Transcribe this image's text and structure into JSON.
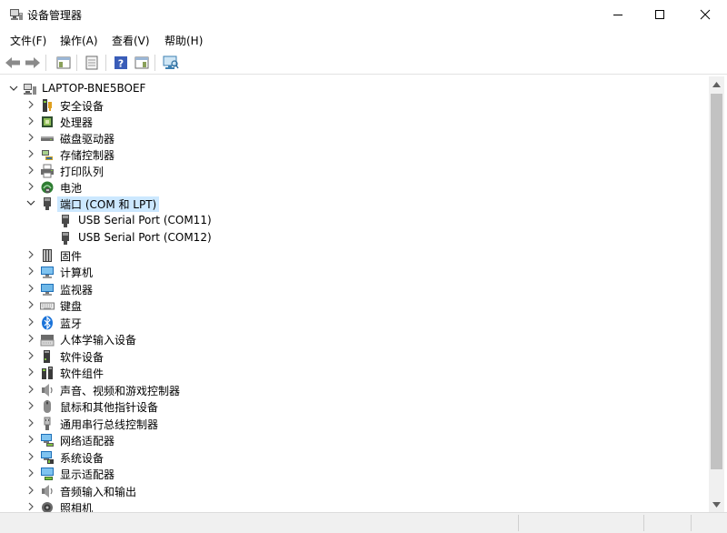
{
  "window": {
    "title": "设备管理器",
    "controls": {
      "minimize": "—",
      "maximize": "☐",
      "close": "✕"
    }
  },
  "menu": [
    {
      "label": "文件(F)"
    },
    {
      "label": "操作(A)"
    },
    {
      "label": "查看(V)"
    },
    {
      "label": "帮助(H)"
    }
  ],
  "toolbar": {
    "buttons": [
      "back-arrow-icon",
      "forward-arrow-icon",
      "show-hide-tree-icon",
      "properties-icon",
      "help-icon",
      "console-icon",
      "monitor-scan-icon"
    ]
  },
  "tree": {
    "root": "LAPTOP-BNE5BOEF",
    "items": [
      {
        "label": "安全设备",
        "icon": "security-device-icon"
      },
      {
        "label": "处理器",
        "icon": "processor-icon"
      },
      {
        "label": "磁盘驱动器",
        "icon": "disk-drive-icon"
      },
      {
        "label": "存储控制器",
        "icon": "storage-controller-icon"
      },
      {
        "label": "打印队列",
        "icon": "printer-icon"
      },
      {
        "label": "电池",
        "icon": "battery-icon"
      },
      {
        "label": "端口 (COM 和 LPT)",
        "icon": "port-icon",
        "expanded": true,
        "selected": true,
        "children": [
          {
            "label": "USB Serial Port (COM11)",
            "icon": "port-icon"
          },
          {
            "label": "USB Serial Port (COM12)",
            "icon": "port-icon"
          }
        ]
      },
      {
        "label": "固件",
        "icon": "firmware-icon"
      },
      {
        "label": "计算机",
        "icon": "computer-icon"
      },
      {
        "label": "监视器",
        "icon": "monitor-icon"
      },
      {
        "label": "键盘",
        "icon": "keyboard-icon"
      },
      {
        "label": "蓝牙",
        "icon": "bluetooth-icon"
      },
      {
        "label": "人体学输入设备",
        "icon": "hid-icon"
      },
      {
        "label": "软件设备",
        "icon": "software-device-icon"
      },
      {
        "label": "软件组件",
        "icon": "software-component-icon"
      },
      {
        "label": "声音、视频和游戏控制器",
        "icon": "sound-icon"
      },
      {
        "label": "鼠标和其他指针设备",
        "icon": "mouse-icon"
      },
      {
        "label": "通用串行总线控制器",
        "icon": "usb-icon"
      },
      {
        "label": "网络适配器",
        "icon": "network-adapter-icon"
      },
      {
        "label": "系统设备",
        "icon": "system-device-icon"
      },
      {
        "label": "显示适配器",
        "icon": "display-adapter-icon"
      },
      {
        "label": "音频输入和输出",
        "icon": "audio-io-icon"
      },
      {
        "label": "照相机",
        "icon": "camera-icon"
      }
    ]
  },
  "colors": {
    "selection": "#cce8ff",
    "chevron": "#555555",
    "scroll_thumb": "#c2c2c2"
  }
}
